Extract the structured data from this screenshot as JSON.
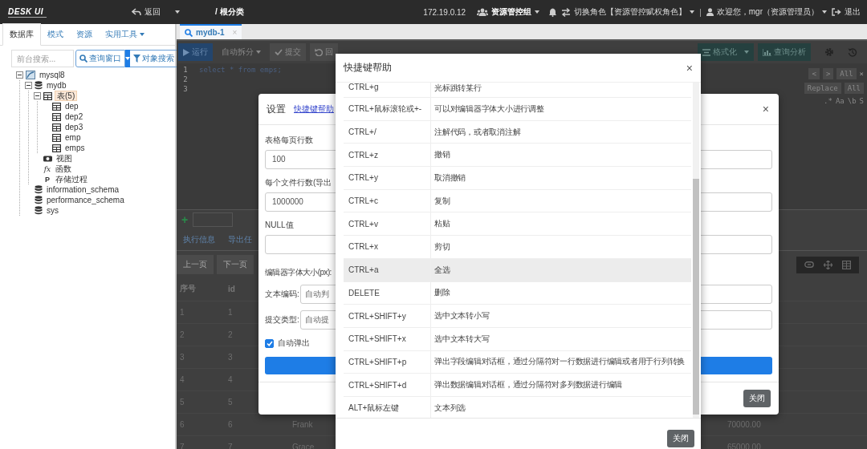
{
  "top_bar": {
    "logo": "DESK UI",
    "back": "返回",
    "breadcrumb": "/ 根分类",
    "ip": "172.19.0.12",
    "group": "资源管控组",
    "role": "切换角色【资源管控赋权角色】",
    "separator": "|",
    "user": "欢迎您，mgr（资源管理员）",
    "logout": "退出"
  },
  "sidebar": {
    "tabs": [
      {
        "label": "数据库",
        "selected": true,
        "dropdown": false
      },
      {
        "label": "模式",
        "selected": false,
        "dropdown": false
      },
      {
        "label": "资源",
        "selected": false,
        "dropdown": false
      },
      {
        "label": "实用工具",
        "selected": false,
        "dropdown": true
      }
    ],
    "search": {
      "placeholder": "前台搜索..."
    },
    "query_button": "查询窗口",
    "object_search_button": "对象搜索",
    "tree": [
      {
        "label": "mysql8",
        "kind": "server",
        "selected": false,
        "expanded": true,
        "children": [
          {
            "label": "mydb",
            "kind": "database",
            "selected": false,
            "expanded": true,
            "children": [
              {
                "label": "表(5)",
                "kind": "tables",
                "selected": true,
                "expanded": true,
                "children": [
                  {
                    "label": "dep",
                    "kind": "table",
                    "selected": false
                  },
                  {
                    "label": "dep2",
                    "kind": "table",
                    "selected": false
                  },
                  {
                    "label": "dep3",
                    "kind": "table",
                    "selected": false
                  },
                  {
                    "label": "emp",
                    "kind": "table",
                    "selected": false
                  },
                  {
                    "label": "emps",
                    "kind": "table",
                    "selected": false
                  }
                ]
              },
              {
                "label": "视图",
                "kind": "views",
                "selected": false
              },
              {
                "label": "函数",
                "kind": "functions",
                "icon_text": "fx",
                "selected": false
              },
              {
                "label": "存储过程",
                "kind": "procedures",
                "icon_text": "P",
                "selected": false
              }
            ]
          },
          {
            "label": "information_schema",
            "kind": "database",
            "selected": false
          },
          {
            "label": "performance_schema",
            "kind": "database",
            "selected": false
          },
          {
            "label": "sys",
            "kind": "database",
            "selected": false
          }
        ]
      }
    ]
  },
  "editor_tab": {
    "label": "mydb-1",
    "close": "×",
    "selected": true
  },
  "toolbar": {
    "left": [
      {
        "kind": "run",
        "label": "运行"
      },
      {
        "kind": "menu",
        "label": "自动拆分"
      },
      {
        "kind": "commit",
        "label": "提交"
      },
      {
        "kind": "rollback",
        "label": "回"
      }
    ],
    "right": [
      {
        "kind": "format",
        "label": "格式化"
      },
      {
        "kind": "analyze",
        "label": "查询分析"
      }
    ]
  },
  "editor": {
    "line_numbers": [
      "1",
      "2",
      "3"
    ],
    "code": "select * from emps;"
  },
  "find_panel": {
    "prev": "<",
    "next": ">",
    "all": "All",
    "close": "×",
    "replace": "Replace",
    "replace_all": "All",
    "options": [
      ".*",
      "Aa",
      "\\b",
      "S"
    ]
  },
  "results": {
    "add": "+",
    "tabs": [
      "执行信息",
      "导出任"
    ],
    "pager": [
      "上一页",
      "下一页"
    ],
    "columns": [
      "序号",
      "id"
    ],
    "rows": [
      {
        "index": "1",
        "id": "1"
      },
      {
        "index": "2",
        "id": "2"
      },
      {
        "index": "3",
        "id": "3"
      },
      {
        "index": "4",
        "id": "4"
      },
      {
        "index": "5",
        "id": "5"
      },
      {
        "index": "6",
        "id": "6",
        "column_3": "Frank",
        "column_4": "70000.00"
      },
      {
        "index": "7",
        "id": "7",
        "column_3": "Grace",
        "column_4": "65000.00"
      }
    ]
  },
  "settings_dialog": {
    "title": "设置",
    "link": "快捷键帮助",
    "close": "×",
    "fields": [
      {
        "kind": "input",
        "label": "表格每页行数",
        "value": "100"
      },
      {
        "kind": "input",
        "label": "每个文件行数(导出",
        "value": "1000000"
      },
      {
        "kind": "input",
        "label": "NULL值"
      },
      {
        "kind": "label",
        "label": "编辑器字体大小(px):"
      },
      {
        "kind": "select",
        "label": "文本编码:",
        "value": "自动判"
      },
      {
        "kind": "select",
        "label": "提交类型:",
        "value": "自动提"
      },
      {
        "kind": "checkbox",
        "label": "自动弹出",
        "checked": true
      },
      {
        "kind": "button"
      }
    ],
    "footer_button": "关闭"
  },
  "shortcut_dialog": {
    "title": "快捷键帮助",
    "close": "×",
    "rows": [
      {
        "keys": "CTRL+g",
        "action": "光标跳转某行",
        "highlighted": false
      },
      {
        "keys": "CTRL+鼠标滚轮或+-",
        "action": "可以对编辑器字体大小进行调整",
        "highlighted": false
      },
      {
        "keys": "CTRL+/",
        "action": "注解代码，或者取消注解",
        "highlighted": false
      },
      {
        "keys": "CTRL+z",
        "action": "撤销",
        "highlighted": false
      },
      {
        "keys": "CTRL+y",
        "action": "取消撤销",
        "highlighted": false
      },
      {
        "keys": "CTRL+c",
        "action": "复制",
        "highlighted": false
      },
      {
        "keys": "CTRL+v",
        "action": "粘贴",
        "highlighted": false
      },
      {
        "keys": "CTRL+x",
        "action": "剪切",
        "highlighted": false
      },
      {
        "keys": "CTRL+a",
        "action": "全选",
        "highlighted": true
      },
      {
        "keys": "DELETE",
        "action": "删除",
        "highlighted": false
      },
      {
        "keys": "CTRL+SHIFT+y",
        "action": "选中文本转小写",
        "highlighted": false
      },
      {
        "keys": "CTRL+SHIFT+x",
        "action": "选中文本转大写",
        "highlighted": false
      },
      {
        "keys": "CTRL+SHIFT+p",
        "action": "弹出字段编辑对话框，通过分隔符对一行数据进行编辑或者用于行列转换",
        "highlighted": false
      },
      {
        "keys": "CTRL+SHIFT+d",
        "action": "弹出数据编辑对话框，通过分隔符对多列数据进行编辑",
        "highlighted": false
      },
      {
        "keys": "ALT+鼠标左键",
        "action": "文本列选",
        "highlighted": false
      }
    ],
    "footer_button": "关闭"
  }
}
